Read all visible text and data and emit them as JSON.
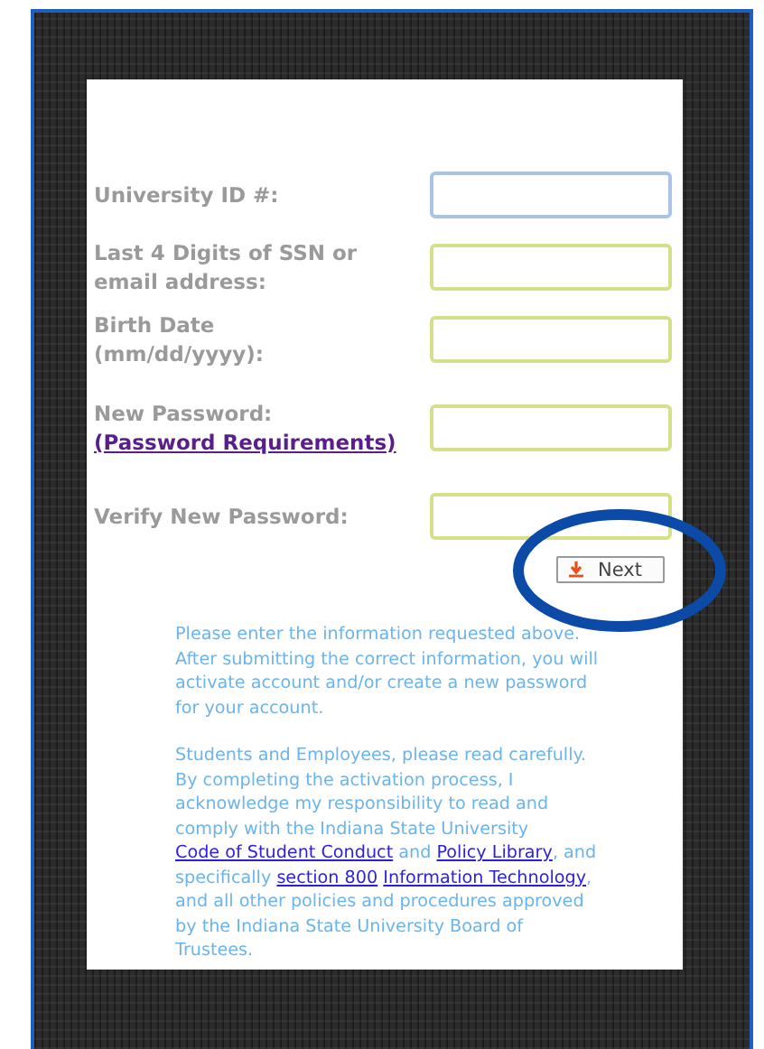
{
  "form": {
    "fields": [
      {
        "label": "University ID #:",
        "focused": true
      },
      {
        "label": "Last 4 Digits of SSN or email address:",
        "focused": false
      },
      {
        "label": "Birth Date (mm/dd/yyyy):",
        "focused": false
      },
      {
        "label": "New Password:",
        "link": "(Password Requirements)",
        "focused": false
      },
      {
        "label": "Verify New Password:",
        "focused": false
      }
    ],
    "next_button": "Next"
  },
  "info": [
    [
      {
        "kind": "text",
        "text": "Please enter the information requested above. After submitting the correct information, you will activate account and/or create a new password for your account."
      }
    ],
    [
      {
        "kind": "text",
        "text": "Students and Employees, please read carefully. By completing the activation process, I acknowledge my responsibility to read and comply with the Indiana State University "
      },
      {
        "kind": "link",
        "text": "Code of Student Conduct"
      },
      {
        "kind": "text",
        "text": " and "
      },
      {
        "kind": "link",
        "text": "Policy Library"
      },
      {
        "kind": "text",
        "text": ", and specifically "
      },
      {
        "kind": "link",
        "text": "section 800"
      },
      {
        "kind": "link",
        "text": "Information Technology"
      },
      {
        "kind": "text",
        "text": ", and all other policies and procedures approved by the Indiana State University Board of Trustees."
      }
    ]
  ]
}
